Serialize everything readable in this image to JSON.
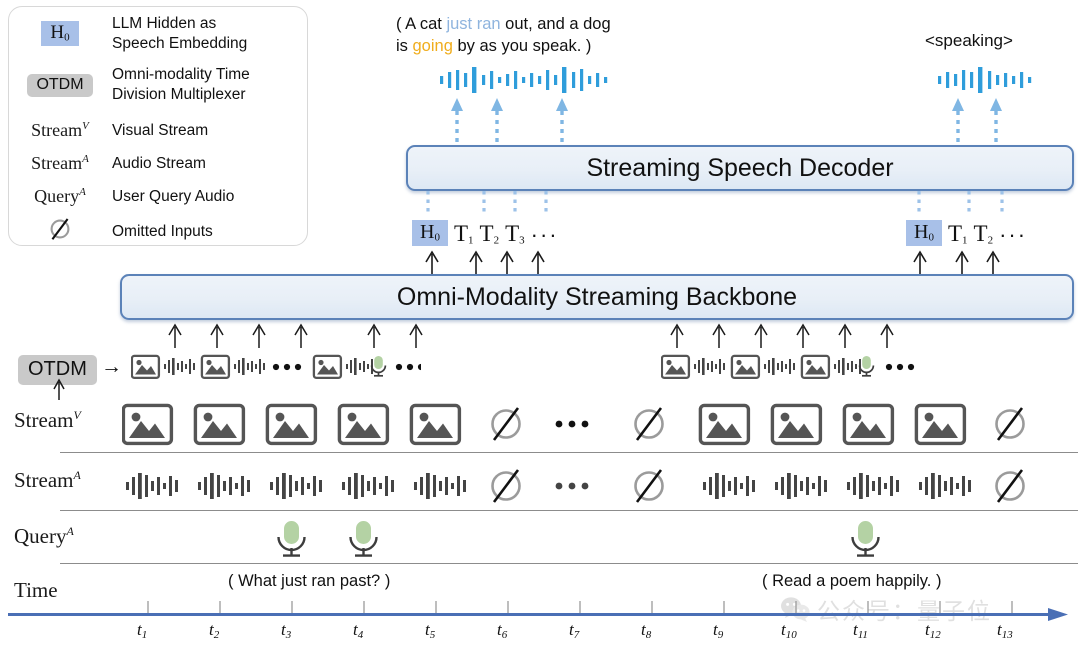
{
  "legend": {
    "items": [
      {
        "symbol": "H0",
        "symbol_kind": "chip-h0",
        "text": "LLM Hidden as\nSpeech Embedding"
      },
      {
        "symbol": "OTDM",
        "symbol_kind": "chip-otdm",
        "text": "Omni-modality Time\nDivision Multiplexer"
      },
      {
        "symbol": "Stream^V",
        "symbol_kind": "math",
        "text": "Visual Stream"
      },
      {
        "symbol": "Stream^A",
        "symbol_kind": "math",
        "text": "Audio Stream"
      },
      {
        "symbol": "Query^A",
        "symbol_kind": "math",
        "text": "User Query Audio"
      },
      {
        "symbol": "∅",
        "symbol_kind": "glyph",
        "text": "Omitted Inputs"
      }
    ]
  },
  "output": {
    "left_caption_line1_pre": "( A cat ",
    "left_caption_line1_hl": "just ran",
    "left_caption_line1_post": " out, and a dog",
    "left_caption_line2_pre": "is ",
    "left_caption_line2_hl": "going",
    "left_caption_line2_post": " by as you speak. )",
    "right_caption": "<speaking>"
  },
  "decoder": {
    "title": "Streaming Speech Decoder"
  },
  "backbone": {
    "title": "Omni-Modality Streaming Backbone"
  },
  "tokens": {
    "left": {
      "hidden": "H",
      "hidden_sub": "0",
      "items": [
        "T1",
        "T2",
        "T3"
      ],
      "ellipsis": "···"
    },
    "right": {
      "hidden": "H",
      "hidden_sub": "0",
      "items": [
        "T1",
        "T2"
      ],
      "ellipsis": "···"
    }
  },
  "otdm": {
    "label": "OTDM",
    "arrow": "→",
    "ellipsis": "•••"
  },
  "rows": {
    "stream_v": {
      "label": "Stream",
      "sup": "V"
    },
    "stream_a": {
      "label": "Stream",
      "sup": "A"
    },
    "query_a": {
      "label": "Query",
      "sup": "A"
    },
    "time": {
      "label": "Time"
    }
  },
  "queries": {
    "left_text": "( What just ran past? )",
    "right_text": "( Read a poem happily. )"
  },
  "timeline": {
    "ticks": [
      "t1",
      "t2",
      "t3",
      "t4",
      "t5",
      "t6",
      "t7",
      "t8",
      "t9",
      "t10",
      "t11",
      "t12",
      "t13"
    ],
    "base": "t"
  },
  "grid_ellipsis": "• • •",
  "watermark": {
    "text": "公众号：量子位"
  },
  "colors": {
    "accent_blue": "#4a6fb5",
    "box_border": "#5b82b8",
    "box_fill": "#eaf1f8",
    "token_highlight": "#a8c0e8",
    "otdm_chip": "#c9c9c9",
    "mic_green": "#b4d2a4",
    "waveform_blue": "#2f9ddb",
    "waveform_gray": "#555555",
    "caption_blue": "#8fb4de",
    "caption_orange": "#f0ad1d"
  },
  "chart_data": {
    "type": "table",
    "title": "Omni-modality streaming timeline",
    "xlabel": "Time",
    "categories": [
      "t1",
      "t2",
      "t3",
      "t4",
      "t5",
      "t6",
      "t7",
      "t8",
      "t9",
      "t10",
      "t11",
      "t12",
      "t13"
    ],
    "series": [
      {
        "name": "Stream^V",
        "values": [
          "image",
          "image",
          "image",
          "image",
          "image",
          "omitted",
          "ellipsis",
          "omitted",
          "image",
          "image",
          "image",
          "image",
          "omitted"
        ]
      },
      {
        "name": "Stream^A",
        "values": [
          "audio",
          "audio",
          "audio",
          "audio",
          "audio",
          "omitted",
          "ellipsis",
          "omitted",
          "audio",
          "audio",
          "audio",
          "audio",
          "omitted"
        ]
      },
      {
        "name": "Query^A",
        "values": [
          "",
          "",
          "mic",
          "mic",
          "",
          "",
          "",
          "",
          "",
          "",
          "mic",
          "",
          ""
        ]
      }
    ]
  }
}
